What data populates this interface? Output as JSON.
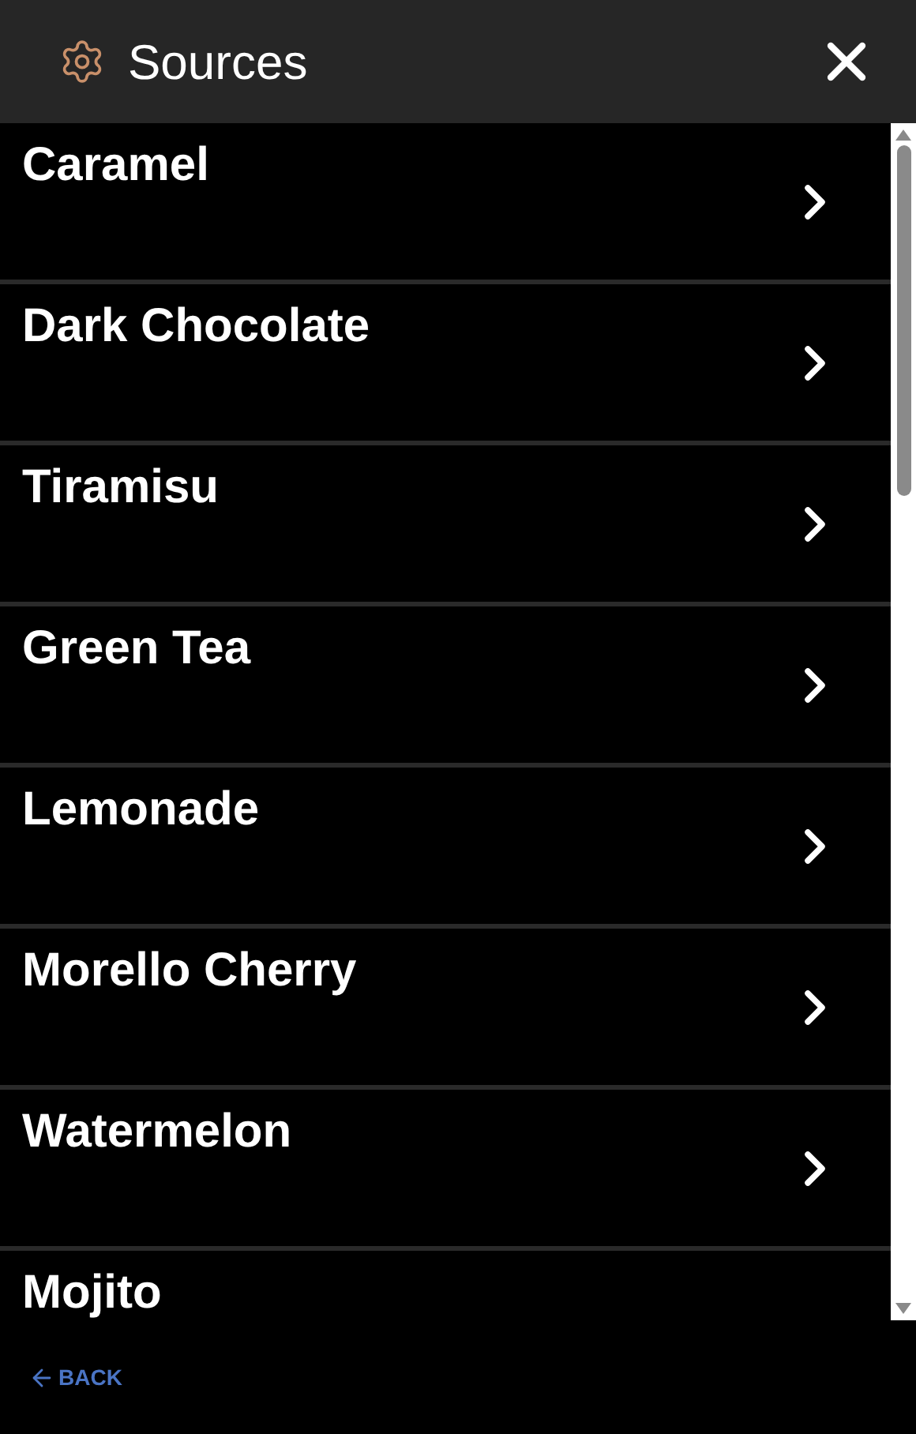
{
  "header": {
    "title": "Sources"
  },
  "items": [
    {
      "label": "Caramel"
    },
    {
      "label": "Dark Chocolate"
    },
    {
      "label": "Tiramisu"
    },
    {
      "label": "Green Tea"
    },
    {
      "label": "Lemonade"
    },
    {
      "label": "Morello Cherry"
    },
    {
      "label": "Watermelon"
    },
    {
      "label": "Mojito"
    }
  ],
  "footer": {
    "back": "BACK"
  }
}
